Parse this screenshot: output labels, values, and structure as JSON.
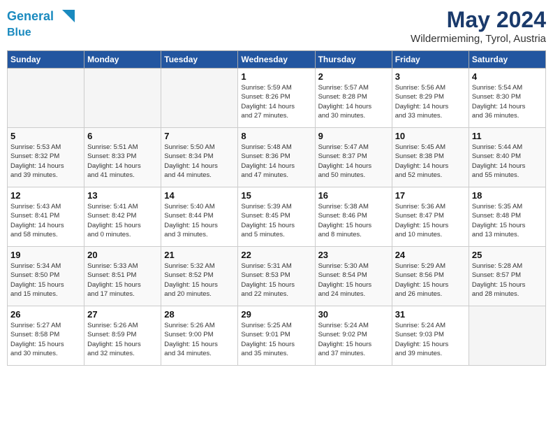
{
  "header": {
    "logo_line1": "General",
    "logo_line2": "Blue",
    "month": "May 2024",
    "location": "Wildermieming, Tyrol, Austria"
  },
  "days_of_week": [
    "Sunday",
    "Monday",
    "Tuesday",
    "Wednesday",
    "Thursday",
    "Friday",
    "Saturday"
  ],
  "weeks": [
    [
      {
        "num": "",
        "info": ""
      },
      {
        "num": "",
        "info": ""
      },
      {
        "num": "",
        "info": ""
      },
      {
        "num": "1",
        "info": "Sunrise: 5:59 AM\nSunset: 8:26 PM\nDaylight: 14 hours\nand 27 minutes."
      },
      {
        "num": "2",
        "info": "Sunrise: 5:57 AM\nSunset: 8:28 PM\nDaylight: 14 hours\nand 30 minutes."
      },
      {
        "num": "3",
        "info": "Sunrise: 5:56 AM\nSunset: 8:29 PM\nDaylight: 14 hours\nand 33 minutes."
      },
      {
        "num": "4",
        "info": "Sunrise: 5:54 AM\nSunset: 8:30 PM\nDaylight: 14 hours\nand 36 minutes."
      }
    ],
    [
      {
        "num": "5",
        "info": "Sunrise: 5:53 AM\nSunset: 8:32 PM\nDaylight: 14 hours\nand 39 minutes."
      },
      {
        "num": "6",
        "info": "Sunrise: 5:51 AM\nSunset: 8:33 PM\nDaylight: 14 hours\nand 41 minutes."
      },
      {
        "num": "7",
        "info": "Sunrise: 5:50 AM\nSunset: 8:34 PM\nDaylight: 14 hours\nand 44 minutes."
      },
      {
        "num": "8",
        "info": "Sunrise: 5:48 AM\nSunset: 8:36 PM\nDaylight: 14 hours\nand 47 minutes."
      },
      {
        "num": "9",
        "info": "Sunrise: 5:47 AM\nSunset: 8:37 PM\nDaylight: 14 hours\nand 50 minutes."
      },
      {
        "num": "10",
        "info": "Sunrise: 5:45 AM\nSunset: 8:38 PM\nDaylight: 14 hours\nand 52 minutes."
      },
      {
        "num": "11",
        "info": "Sunrise: 5:44 AM\nSunset: 8:40 PM\nDaylight: 14 hours\nand 55 minutes."
      }
    ],
    [
      {
        "num": "12",
        "info": "Sunrise: 5:43 AM\nSunset: 8:41 PM\nDaylight: 14 hours\nand 58 minutes."
      },
      {
        "num": "13",
        "info": "Sunrise: 5:41 AM\nSunset: 8:42 PM\nDaylight: 15 hours\nand 0 minutes."
      },
      {
        "num": "14",
        "info": "Sunrise: 5:40 AM\nSunset: 8:44 PM\nDaylight: 15 hours\nand 3 minutes."
      },
      {
        "num": "15",
        "info": "Sunrise: 5:39 AM\nSunset: 8:45 PM\nDaylight: 15 hours\nand 5 minutes."
      },
      {
        "num": "16",
        "info": "Sunrise: 5:38 AM\nSunset: 8:46 PM\nDaylight: 15 hours\nand 8 minutes."
      },
      {
        "num": "17",
        "info": "Sunrise: 5:36 AM\nSunset: 8:47 PM\nDaylight: 15 hours\nand 10 minutes."
      },
      {
        "num": "18",
        "info": "Sunrise: 5:35 AM\nSunset: 8:48 PM\nDaylight: 15 hours\nand 13 minutes."
      }
    ],
    [
      {
        "num": "19",
        "info": "Sunrise: 5:34 AM\nSunset: 8:50 PM\nDaylight: 15 hours\nand 15 minutes."
      },
      {
        "num": "20",
        "info": "Sunrise: 5:33 AM\nSunset: 8:51 PM\nDaylight: 15 hours\nand 17 minutes."
      },
      {
        "num": "21",
        "info": "Sunrise: 5:32 AM\nSunset: 8:52 PM\nDaylight: 15 hours\nand 20 minutes."
      },
      {
        "num": "22",
        "info": "Sunrise: 5:31 AM\nSunset: 8:53 PM\nDaylight: 15 hours\nand 22 minutes."
      },
      {
        "num": "23",
        "info": "Sunrise: 5:30 AM\nSunset: 8:54 PM\nDaylight: 15 hours\nand 24 minutes."
      },
      {
        "num": "24",
        "info": "Sunrise: 5:29 AM\nSunset: 8:56 PM\nDaylight: 15 hours\nand 26 minutes."
      },
      {
        "num": "25",
        "info": "Sunrise: 5:28 AM\nSunset: 8:57 PM\nDaylight: 15 hours\nand 28 minutes."
      }
    ],
    [
      {
        "num": "26",
        "info": "Sunrise: 5:27 AM\nSunset: 8:58 PM\nDaylight: 15 hours\nand 30 minutes."
      },
      {
        "num": "27",
        "info": "Sunrise: 5:26 AM\nSunset: 8:59 PM\nDaylight: 15 hours\nand 32 minutes."
      },
      {
        "num": "28",
        "info": "Sunrise: 5:26 AM\nSunset: 9:00 PM\nDaylight: 15 hours\nand 34 minutes."
      },
      {
        "num": "29",
        "info": "Sunrise: 5:25 AM\nSunset: 9:01 PM\nDaylight: 15 hours\nand 35 minutes."
      },
      {
        "num": "30",
        "info": "Sunrise: 5:24 AM\nSunset: 9:02 PM\nDaylight: 15 hours\nand 37 minutes."
      },
      {
        "num": "31",
        "info": "Sunrise: 5:24 AM\nSunset: 9:03 PM\nDaylight: 15 hours\nand 39 minutes."
      },
      {
        "num": "",
        "info": ""
      }
    ]
  ]
}
